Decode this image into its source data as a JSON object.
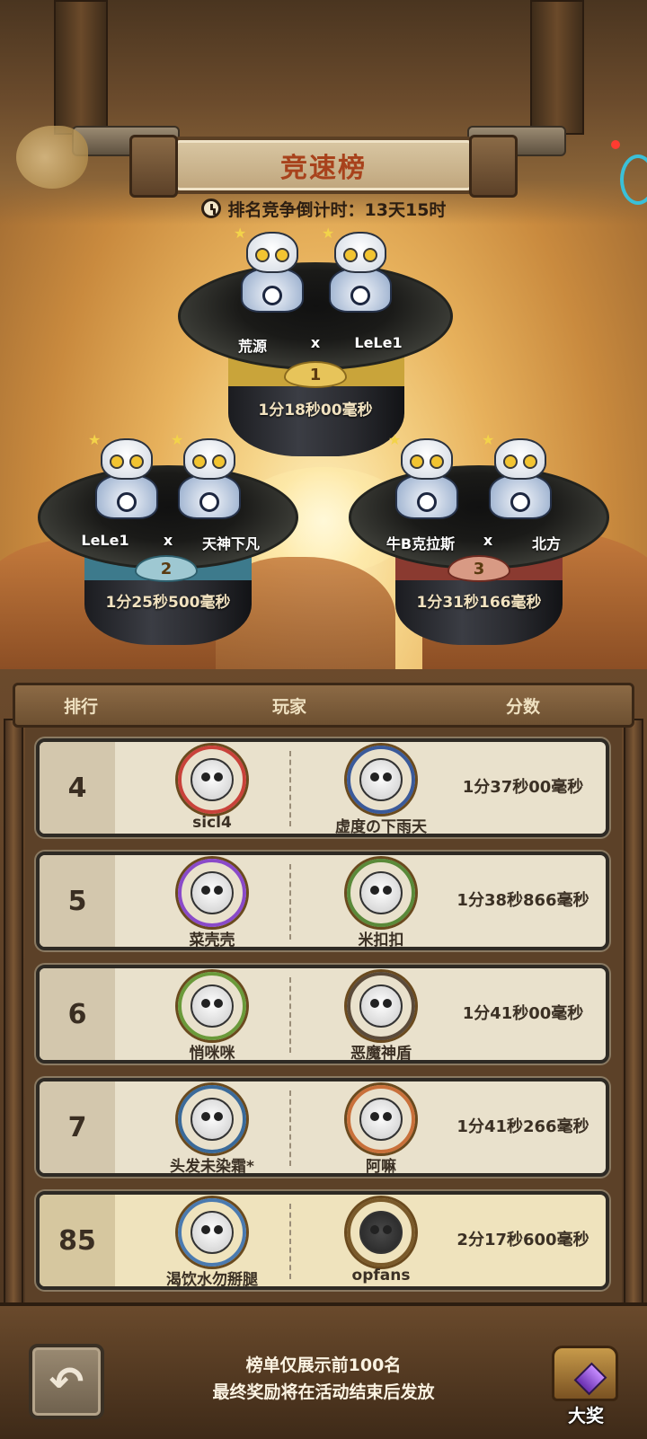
{
  "title": "竞速榜",
  "countdown_label": "排名竞争倒计时：13天15时",
  "podium": [
    {
      "rank": "1",
      "players": [
        "荒源",
        "LeLe1"
      ],
      "separator": "x",
      "time": "1分18秒00毫秒",
      "band_color": "#c9a43a"
    },
    {
      "rank": "2",
      "players": [
        "LeLe1",
        "天神下凡"
      ],
      "separator": "x",
      "time": "1分25秒500毫秒",
      "band_color": "#3d7a8c"
    },
    {
      "rank": "3",
      "players": [
        "牛B克拉斯",
        "北方"
      ],
      "separator": "x",
      "time": "1分31秒166毫秒",
      "band_color": "#8a3a30"
    }
  ],
  "table_headers": {
    "rank": "排行",
    "player": "玩家",
    "score": "分数"
  },
  "rows": [
    {
      "rank": "4",
      "players": [
        "sicl4",
        "虚度の下雨天"
      ],
      "score": "1分37秒00毫秒"
    },
    {
      "rank": "5",
      "players": [
        "菜壳壳",
        "米扣扣"
      ],
      "score": "1分38秒866毫秒"
    },
    {
      "rank": "6",
      "players": [
        "悄咪咪",
        "恶魔神盾"
      ],
      "score": "1分41秒00毫秒"
    },
    {
      "rank": "7",
      "players": [
        "头发未染霜*",
        "阿嘛"
      ],
      "score": "1分41秒266毫秒"
    },
    {
      "rank": "85",
      "players": [
        "渴饮水勿掰腿",
        "opfans"
      ],
      "score": "2分17秒600毫秒"
    }
  ],
  "footer": {
    "note_line1": "榜单仅展示前100名",
    "note_line2": "最终奖励将在活动结束后发放",
    "back_icon": "↶",
    "prize_label": "大奖"
  },
  "colors": {
    "title": "#a8421c",
    "gold": "#c9a43a",
    "silver_blue": "#3d7a8c",
    "bronze_red": "#8a3a30"
  }
}
